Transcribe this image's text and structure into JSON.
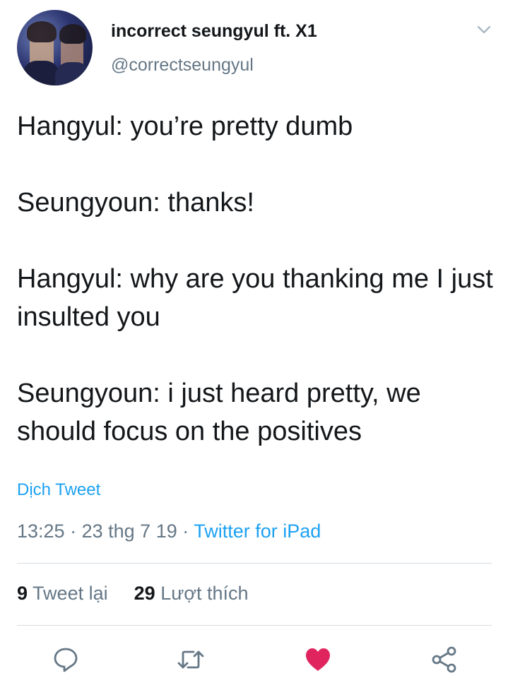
{
  "author": {
    "display_name": "incorrect seungyul ft. X1",
    "handle": "@correctseungyul"
  },
  "tweet": {
    "lines": [
      "Hangyul: you’re pretty dumb",
      "Seungyoun: thanks!",
      "Hangyul: why are you thanking me I just insulted you",
      "Seungyoun: i just heard pretty, we should focus on the positives"
    ],
    "translate_label": "Dịch Tweet"
  },
  "meta": {
    "time": "13:25",
    "date": "23 thg 7 19",
    "separator": "·",
    "source": "Twitter for iPad"
  },
  "stats": {
    "retweets_count": "9",
    "retweets_label": "Tweet lại",
    "likes_count": "29",
    "likes_label": "Lượt thích"
  },
  "actions": {
    "reply_icon": "reply-icon",
    "retweet_icon": "retweet-icon",
    "like_icon": "heart-icon",
    "share_icon": "share-icon"
  },
  "colors": {
    "accent": "#1da1f2",
    "like": "#e0245e",
    "muted": "#657786",
    "text": "#14171a"
  }
}
